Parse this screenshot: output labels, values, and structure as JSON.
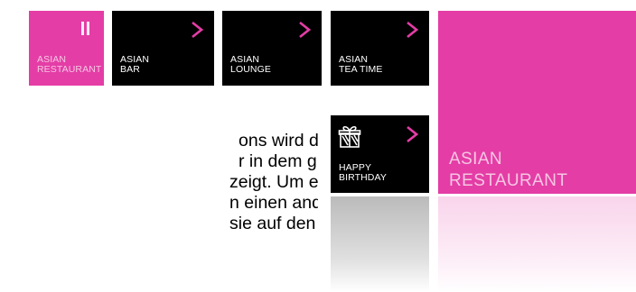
{
  "tiles": [
    {
      "line1": "ASIAN",
      "line2": "RESTAURANT",
      "state": "playing"
    },
    {
      "line1": "ASIAN",
      "line2": "BAR",
      "state": "chevron"
    },
    {
      "line1": "ASIAN",
      "line2": "LOUNGE",
      "state": "chevron"
    },
    {
      "line1": "ASIAN",
      "line2": "TEA TIME",
      "state": "chevron"
    },
    {
      "line1": "HAPPY",
      "line2": "BIRTHDAY",
      "state": "chevron",
      "icon": "gift-icon"
    }
  ],
  "active_station": {
    "line1": "ASIAN",
    "line2": "RESTAURANT"
  },
  "body_text": [
    "ons wird dieser Pink",
    "r in dem großen Feld",
    "zeigt. Um einen Sender",
    "n einen anderen Sender-",
    "sie auf den aktiven, pinken"
  ],
  "colors": {
    "accent": "#e43da6",
    "tile_bg": "#000000",
    "text": "#ffffff"
  }
}
